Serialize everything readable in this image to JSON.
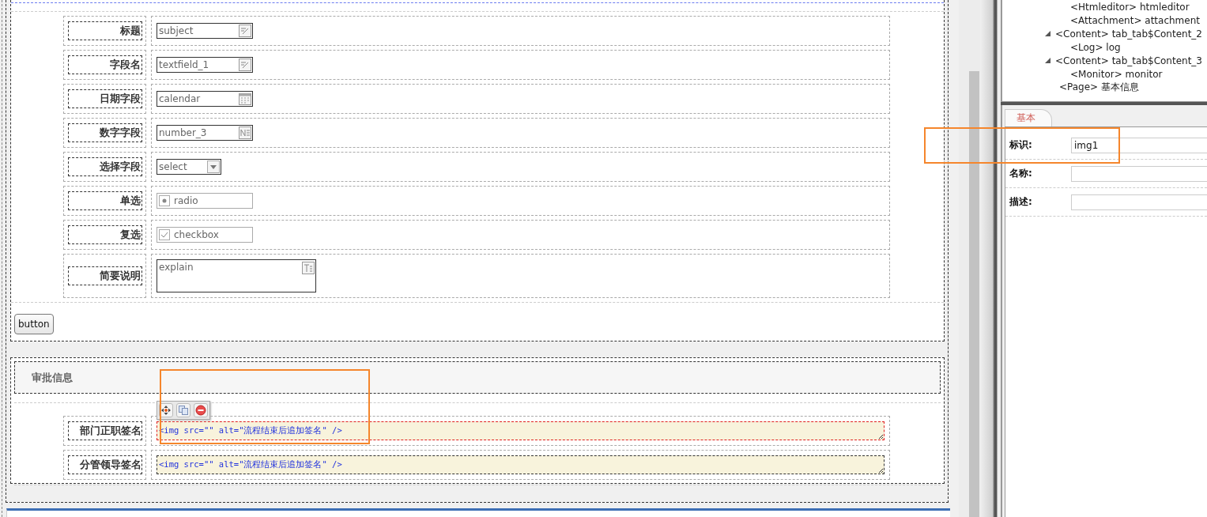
{
  "form": {
    "fields": [
      {
        "label": "标题",
        "kind": "text",
        "value": "subject"
      },
      {
        "label": "字段名",
        "kind": "text",
        "value": "textfield_1"
      },
      {
        "label": "日期字段",
        "kind": "date",
        "value": "calendar"
      },
      {
        "label": "数字字段",
        "kind": "number",
        "value": "number_3"
      },
      {
        "label": "选择字段",
        "kind": "select",
        "value": "select"
      },
      {
        "label": "单选",
        "kind": "radio",
        "value": "radio",
        "checked": true
      },
      {
        "label": "复选",
        "kind": "checkbox",
        "value": "checkbox",
        "checked": true
      },
      {
        "label": "简要说明",
        "kind": "textarea",
        "value": "explain"
      }
    ],
    "button": "button"
  },
  "approval": {
    "title": "审批信息",
    "signatures": [
      {
        "label": "部门正职签名",
        "value": "<img src=\"\" alt=\"流程结束后追加签名\" />",
        "selected": true
      },
      {
        "label": "分管领导签名",
        "value": "<img src=\"\" alt=\"流程结束后追加签名\" />",
        "selected": false
      }
    ]
  },
  "tree": {
    "continued_children": [
      {
        "label": "<Htmleditor> htmleditor"
      },
      {
        "label": "<Attachment> attachment"
      }
    ],
    "items": [
      {
        "label": "<Content> tab_tab$Content_2",
        "expanded": true,
        "children": [
          {
            "label": "<Log> log"
          }
        ]
      },
      {
        "label": "<Content> tab_tab$Content_3",
        "expanded": true,
        "children": [
          {
            "label": "<Monitor> monitor"
          }
        ]
      },
      {
        "label": "<Page> 基本信息"
      }
    ]
  },
  "properties": {
    "tabs": [
      {
        "label": "基本",
        "selected": true
      }
    ],
    "rows": [
      {
        "label": "标识:",
        "value": "img1"
      },
      {
        "label": "名称:"
      },
      {
        "label": "描述:"
      }
    ]
  }
}
